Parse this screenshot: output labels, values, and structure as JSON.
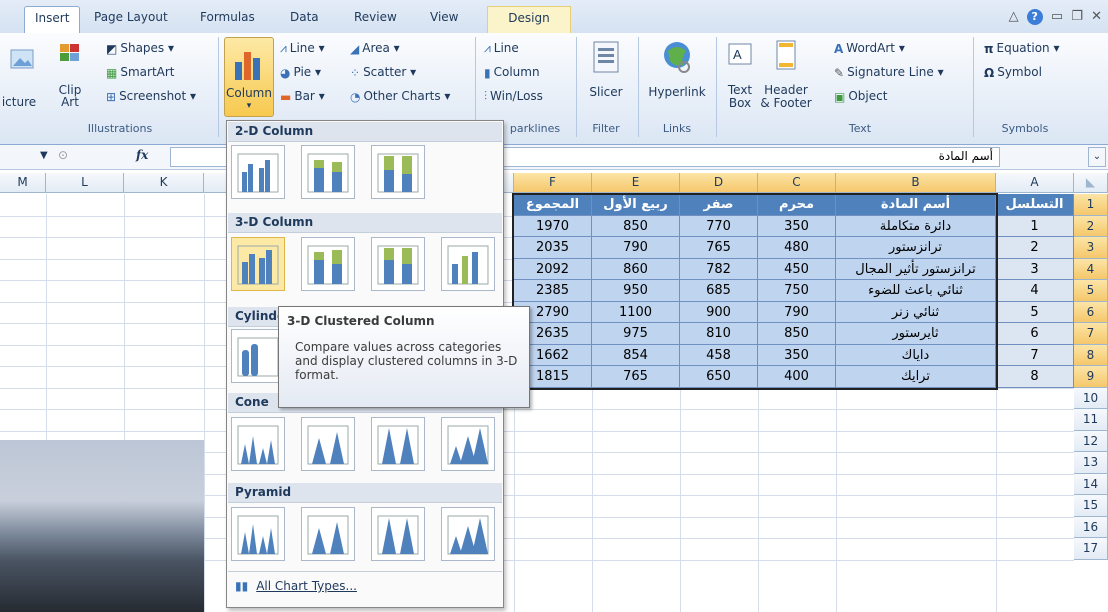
{
  "tabs": [
    "Insert",
    "Page Layout",
    "Formulas",
    "Data",
    "Review",
    "View",
    "Design"
  ],
  "ribbon": {
    "illustrations": {
      "picture": "icture",
      "clip_art": "Clip\nArt",
      "shapes": "Shapes",
      "smartart": "SmartArt",
      "screenshot": "Screenshot",
      "label": "Illustrations"
    },
    "charts": {
      "column": "Column",
      "line": "Line",
      "area": "Area",
      "pie": "Pie",
      "scatter": "Scatter",
      "bar": "Bar",
      "other": "Other Charts"
    },
    "sparklines": {
      "line": "Line",
      "column": "Column",
      "winloss": "Win/Loss",
      "label": "parklines"
    },
    "filter": {
      "slicer": "Slicer",
      "label": "Filter"
    },
    "links": {
      "hyperlink": "Hyperlink",
      "label": "Links"
    },
    "text": {
      "textbox_1": "Text",
      "textbox_2": "Box",
      "header_1": "Header",
      "header_2": "& Footer",
      "wordart": "WordArt",
      "signature": "Signature Line",
      "object": "Object",
      "label": "Text"
    },
    "symbols": {
      "equation": "Equation",
      "symbol": "Symbol",
      "label": "Symbols"
    }
  },
  "formula_bar": {
    "fx": "fx",
    "value": "أسم المادة"
  },
  "columns": [
    "M",
    "L",
    "K",
    "F",
    "E",
    "D",
    "C",
    "B",
    "A"
  ],
  "row_numbers": [
    "1",
    "2",
    "3",
    "4",
    "5",
    "6",
    "7",
    "8",
    "9",
    "10",
    "11",
    "12",
    "13",
    "14",
    "15",
    "16",
    "17"
  ],
  "table": {
    "headers": [
      "المجموع",
      "ربيع الأول",
      "صفر",
      "محرم",
      "أسم المادة",
      "التسلسل"
    ],
    "rows": [
      [
        "1970",
        "850",
        "770",
        "350",
        "دائرة متكاملة",
        "1"
      ],
      [
        "2035",
        "790",
        "765",
        "480",
        "ترانزستور",
        "2"
      ],
      [
        "2092",
        "860",
        "782",
        "450",
        "ترانزستور تأثير المجال",
        "3"
      ],
      [
        "2385",
        "950",
        "685",
        "750",
        "ثنائي باعث للضوء",
        "4"
      ],
      [
        "2790",
        "1100",
        "900",
        "790",
        "ثنائي زنر",
        "5"
      ],
      [
        "2635",
        "975",
        "810",
        "850",
        "ثايرستور",
        "6"
      ],
      [
        "1662",
        "854",
        "458",
        "350",
        "داياك",
        "7"
      ],
      [
        "1815",
        "765",
        "650",
        "400",
        "ترايك",
        "8"
      ]
    ]
  },
  "dropdown": {
    "sections": [
      "2-D Column",
      "3-D Column",
      "Cylinder",
      "Cone",
      "Pyramid"
    ],
    "all_chart_types": "All Chart Types..."
  },
  "tooltip": {
    "title": "3-D Clustered Column",
    "body": "Compare values across categories and display clustered columns in 3-D format."
  },
  "colors": {
    "accent": "#4f81bd",
    "ribbon": "#dbe6f4",
    "selection": "#f7c94f"
  }
}
